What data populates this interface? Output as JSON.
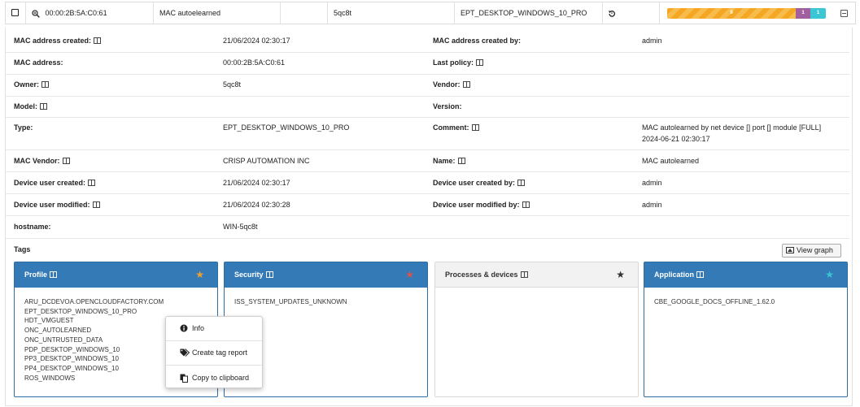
{
  "top_row": {
    "mac": "00:00:2B:5A:C0:61",
    "name": "MAC autoelearned",
    "owner": "5qc8t",
    "type": "EPT_DESKTOP_WINDOWS_10_PRO",
    "bar": {
      "orange_value": "9",
      "purple_value": "1",
      "cyan_value": "1",
      "orange_color": "#f5a623",
      "purple_color": "#a15fa0",
      "cyan_color": "#3cc6d4"
    }
  },
  "details": [
    {
      "label": "MAC address created:",
      "value": "21/06/2024 02:30:17",
      "label2": "MAC address created by:",
      "value2": "admin"
    },
    {
      "label": "MAC address:",
      "value": "00:00:2B:5A:C0:61",
      "label2": "Last policy:",
      "value2": ""
    },
    {
      "label": "Owner:",
      "value": "5qc8t",
      "label2": "Vendor:",
      "value2": ""
    },
    {
      "label": "Model:",
      "value": "",
      "label2": "Version:",
      "value2": ""
    },
    {
      "label": "Type:",
      "value": "EPT_DESKTOP_WINDOWS_10_PRO",
      "label2": "Comment:",
      "value2": "MAC autolearned by net device [] port [] module [FULL]",
      "value2b": "2024-06-21 02:30:17"
    },
    {
      "label": "MAC Vendor:",
      "value": "CRISP AUTOMATION INC",
      "label2": "Name:",
      "value2": "MAC autolearned"
    },
    {
      "label": "Device user created:",
      "value": "21/06/2024 02:30:17",
      "label2": "Device user created by:",
      "value2": "admin"
    },
    {
      "label": "Device user modified:",
      "value": "21/06/2024 02:30:28",
      "label2": "Device user modified by:",
      "value2": "admin"
    },
    {
      "label": "hostname:",
      "value": "WIN-5qc8t"
    }
  ],
  "tags": {
    "title": "Tags",
    "view_graph": "View graph",
    "cards": [
      {
        "title": "Profile",
        "star_color": "#f0a030",
        "items": [
          "ARU_DCDEVOA.OPENCLOUDFACTORY.COM",
          "EPT_DESKTOP_WINDOWS_10_PRO",
          "HDT_VMGUEST",
          "ONC_AUTOLEARNED",
          "ONC_UNTRUSTED_DATA",
          "PDP_DESKTOP_WINDOWS_10",
          "PP3_DESKTOP_WINDOWS_10",
          "PP4_DESKTOP_WINDOWS_10",
          "ROS_WINDOWS"
        ]
      },
      {
        "title": "Security",
        "star_color": "#d9534f",
        "items": [
          "ISS_SYSTEM_UPDATES_UNKNOWN"
        ]
      },
      {
        "title": "Processes & devices",
        "star_color": "#333333",
        "items": []
      },
      {
        "title": "Application",
        "star_color": "#3cc6d4",
        "items": [
          "CBE_GOOGLE_DOCS_OFFLINE_1.62.0"
        ]
      }
    ]
  },
  "context_menu": {
    "info": "Info",
    "create_tag_report": "Create tag report",
    "copy_to_clipboard": "Copy to clipboard"
  }
}
